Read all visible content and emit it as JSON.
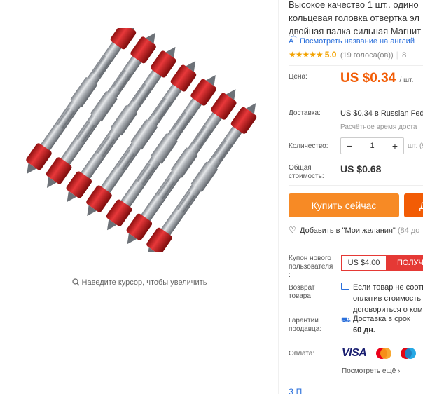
{
  "product": {
    "image_alt": "Магнитные биты отвертки с красной кольцевой головкой",
    "zoom_hint": "Наведите курсор, чтобы увеличить"
  },
  "detail": {
    "title_lines": [
      "Высокое качество 1 шт.. одино",
      "кольцевая головка отвертка эл",
      "двойная палка сильная Магнит"
    ],
    "translate_link": "Посмотреть название на англий",
    "rating": {
      "stars": "★★★★★",
      "score": "5.0",
      "votes": "(19 голоса(ов))",
      "separator": "|",
      "orders_fragment": "8"
    },
    "price": {
      "label": "Цена:",
      "value": "US $0.34",
      "unit": "/ шт."
    },
    "shipping": {
      "label": "Доставка:",
      "value_price": "US $0.34",
      "value_text": " в Russian Fed",
      "sub": "Расчётное время доста"
    },
    "quantity": {
      "label": "Количество:",
      "minus": "−",
      "value": "1",
      "plus": "+",
      "unit": "шт. (9"
    },
    "total": {
      "label_line1": "Общая",
      "label_line2": "стоимость:",
      "value": "US $0.68"
    },
    "buy_now": "Купить сейчас",
    "add_to_cart": "Д",
    "wishlist": {
      "text": "Добавить в \"Мои желания\"",
      "count": "(84 до"
    },
    "coupon": {
      "label_line1": "Купон нового",
      "label_line2": "пользователя",
      "label_line3": ":",
      "amount": "US $4.00",
      "button": "ПОЛУЧ"
    },
    "returns": {
      "label_line1": "Возврат",
      "label_line2": "товара",
      "lines": [
        "Если товар не соотв",
        "оплатив стоимость с",
        "договориться о ком"
      ]
    },
    "guarantee": {
      "label_line1": "Гарантии",
      "label_line2": "продавца:",
      "text": "Доставка в срок",
      "days": "60 дн."
    },
    "payment": {
      "label": "Оплата:",
      "visa": "VISA",
      "see_more": "Посмотреть ещё ›"
    },
    "bottom_fragment": "З          П"
  },
  "colors": {
    "accent_orange": "#f78a25",
    "cart_orange": "#f25c05",
    "price_orange": "#f25c05",
    "coupon_red": "#e53935",
    "link_blue": "#2a6fdb",
    "star_gold": "#f2a200"
  }
}
